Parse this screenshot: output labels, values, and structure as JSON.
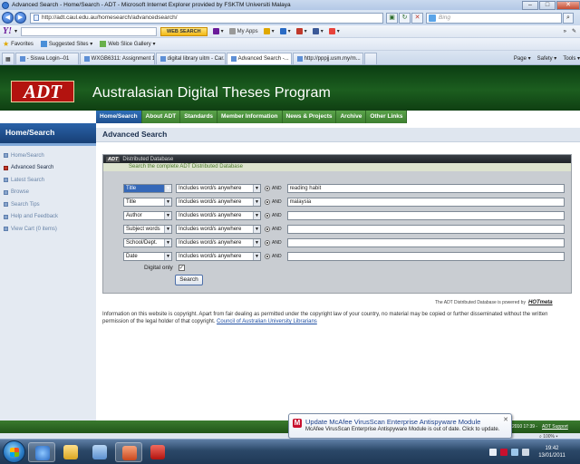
{
  "window": {
    "title": "Advanced Search - Home/Search - ADT - Microsoft Internet Explorer provided by FSKTM Universiti Malaya"
  },
  "address": {
    "url": "http://adt.caul.edu.au/homesearch/advancedsearch/",
    "search_placeholder": "Bing"
  },
  "yahoo_toolbar": {
    "logo": "Y!",
    "web_search_label": "WEB SEARCH",
    "my_apps_label": "My Apps"
  },
  "favorites_bar": {
    "favorites_label": "Favorites",
    "items": [
      "Suggested Sites ▾",
      "Web Slice Gallery ▾"
    ]
  },
  "tabs": {
    "items": [
      {
        "label": "- Siswa Login--01",
        "active": false
      },
      {
        "label": "WXGB6311: Assignment 1 ...",
        "active": false
      },
      {
        "label": "digital library uitm - Car...",
        "active": false
      },
      {
        "label": "Advanced Search -...",
        "active": true
      },
      {
        "label": "http://pppjj.usm.my/m...",
        "active": false
      }
    ],
    "tools": [
      "Page ▾",
      "Safety ▾",
      "Tools ▾"
    ]
  },
  "site": {
    "logo": "ADT",
    "title": "Australasian Digital Theses Program",
    "nav": [
      {
        "label": "Home/Search",
        "active": true
      },
      {
        "label": "About ADT",
        "active": false
      },
      {
        "label": "Standards",
        "active": false
      },
      {
        "label": "Member Information",
        "active": false
      },
      {
        "label": "News & Projects",
        "active": false
      },
      {
        "label": "Archive",
        "active": false
      },
      {
        "label": "Other Links",
        "active": false
      }
    ]
  },
  "sidebar": {
    "heading": "Home/Search",
    "items": [
      {
        "label": "Home/Search",
        "current": false
      },
      {
        "label": "Advanced Search",
        "current": true
      },
      {
        "label": "Latest Search",
        "current": false
      },
      {
        "label": "Browse",
        "current": false
      },
      {
        "label": "Search Tips",
        "current": false
      },
      {
        "label": "Help and Feedback",
        "current": false
      },
      {
        "label": "View Cart (0 items)",
        "current": false
      }
    ]
  },
  "main": {
    "heading": "Advanced Search",
    "panel_logo": "ADT",
    "panel_title": "Distributed Database",
    "panel_subtitle": "Search the complete ADT Distributed Database",
    "rows": [
      {
        "field": "Title",
        "operator": "Includes word/s anywhere",
        "conj": "AND",
        "value": "reading habit",
        "highlight": true
      },
      {
        "field": "Title",
        "operator": "Includes word/s anywhere",
        "conj": "AND",
        "value": "malaysia",
        "highlight": false
      },
      {
        "field": "Author",
        "operator": "Includes word/s anywhere",
        "conj": "AND",
        "value": "",
        "highlight": false
      },
      {
        "field": "Subject words",
        "operator": "Includes word/s anywhere",
        "conj": "AND",
        "value": "",
        "highlight": false
      },
      {
        "field": "School/Dept.",
        "operator": "Includes word/s anywhere",
        "conj": "AND",
        "value": "",
        "highlight": false
      },
      {
        "field": "Date",
        "operator": "Includes word/s anywhere",
        "conj": "AND",
        "value": "",
        "highlight": false
      }
    ],
    "digital_only_label": "Digital only",
    "digital_only_mark": "✓",
    "search_button": "Search",
    "powered_by": "The ADT Distributed Database is powered by",
    "powered_brand": "HOTmeta",
    "info_text": "Information on this website is copyright. Apart from fair dealing as permitted under the copyright law of your country, no material may be copied or further disseminated without the written permission of the legal holder of that copyright.",
    "info_link": "Council of Australian University Librarians"
  },
  "footer": {
    "copyright": "2010 17:39 -",
    "link": "ADT Support"
  },
  "notification": {
    "title": "Update McAfee VirusScan Enterprise Antispyware Module",
    "message": "McAfee VirusScan Enterprise Antispyware Module is out of date. Click to update."
  },
  "status": {
    "zoom": "100%"
  },
  "taskbar": {
    "time": "19:42",
    "date": "13/01/2011"
  }
}
